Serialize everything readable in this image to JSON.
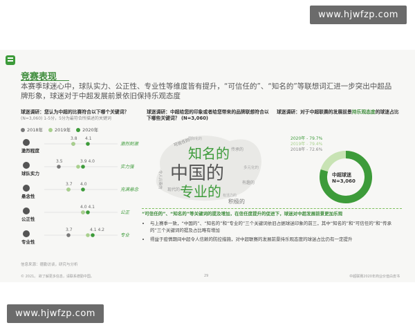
{
  "watermark": {
    "text": "www.hjwfzp.com"
  },
  "slide": {
    "title": "竞赛表现",
    "headline": "本赛季球迷心中，球队实力、公正性、专业性等维度皆有提升，“可信任的”、“知名的”等联想词汇进一步突出中超品牌形象，球迷对于中超发展前景依旧保持乐观态度"
  },
  "survey1": {
    "question": "球迷调研：您认为中超的比赛符合以下哪个关键词？",
    "subnote": "(N=3,060) 1-5分，5分为最符合所描述的关键词",
    "legend": [
      {
        "label": "2018年",
        "color": "#7a7a7a"
      },
      {
        "label": "2019年",
        "color": "#a8d08d"
      },
      {
        "label": "2020年",
        "color": "#3d9b3a"
      }
    ]
  },
  "survey2": {
    "question": "球迷调研：中超给您的印象或者给您带来的品牌联想符合以下哪些关键词？ (N=3,060)"
  },
  "survey3": {
    "question_prefix": "球迷调研：对于中超联赛的发展前景",
    "question_highlight": "持乐观态度",
    "question_suffix": "的球迷占比"
  },
  "chart_data": [
    {
      "type": "scatter",
      "categories": [
        "激烈程度",
        "球队实力",
        "悬念性",
        "公正性",
        "专业性"
      ],
      "tags": [
        "激烈刺激",
        "实力强",
        "充满悬念",
        "公正",
        "专业"
      ],
      "series": [
        {
          "name": "2018年",
          "values": [
            3.8,
            3.5,
            3.7,
            4.0,
            3.7
          ]
        },
        {
          "name": "2019年",
          "values": [
            3.8,
            3.9,
            3.7,
            4.0,
            4.1
          ]
        },
        {
          "name": "2020年",
          "values": [
            4.1,
            4.0,
            4.0,
            4.1,
            4.2
          ]
        }
      ],
      "labels": [
        "3.8",
        "4.1",
        "3.5",
        "3.9 4.0",
        "3.7",
        "4.0",
        "4.0 4.1",
        "3.7",
        "4.1 4.2"
      ],
      "xlim": [
        3.2,
        4.6
      ]
    },
    {
      "type": "pie",
      "center_label": "中超球迷",
      "center_n": "N=3,060",
      "series": [
        {
          "name": "2020年",
          "value": 79.7,
          "label": "2020年 - 79.7%"
        },
        {
          "name": "2019年",
          "value": 79.4,
          "label": "2019年 - 79.4%"
        },
        {
          "name": "2018年",
          "value": 72.6,
          "label": "2018年 - 72.6%"
        }
      ]
    }
  ],
  "wordcloud": {
    "words": [
      "知名的",
      "中国的",
      "专业的",
      "积极的",
      "可信任的",
      "传承的",
      "令人兴奋的",
      "多元化的",
      "现代的",
      "有趣的",
      "国际化的",
      "有活力的"
    ]
  },
  "note": {
    "lead": "“可信任的”、“知名的”等关键词的提及增加，在信任度提升的促进下，球迷对中超发展前景更加乐观",
    "bullets": [
      "与上赛季一致，“中国的”、“知名的”和“专业的”三个关键词依旧占据球迷印象的前三，其中“知名的”和“可信任的”和“传承的”三个关键词的提及占比略有增加",
      "得益于疫情期间中超令人信赖的防控措施，对中超联赛的发展前景持乐观态度的球迷占比仍有一定提升"
    ]
  },
  "source": "信息来源：德勤访谈，研究与分析",
  "footer": {
    "left": "© 2021。 欲了解更多信息，请联系德勤中国。",
    "page": "29",
    "right": "中超联赛2020年商业价值白皮书"
  },
  "colors": {
    "accent": "#3d9b3a",
    "light": "#a8d08d",
    "grey": "#7a7a7a"
  }
}
